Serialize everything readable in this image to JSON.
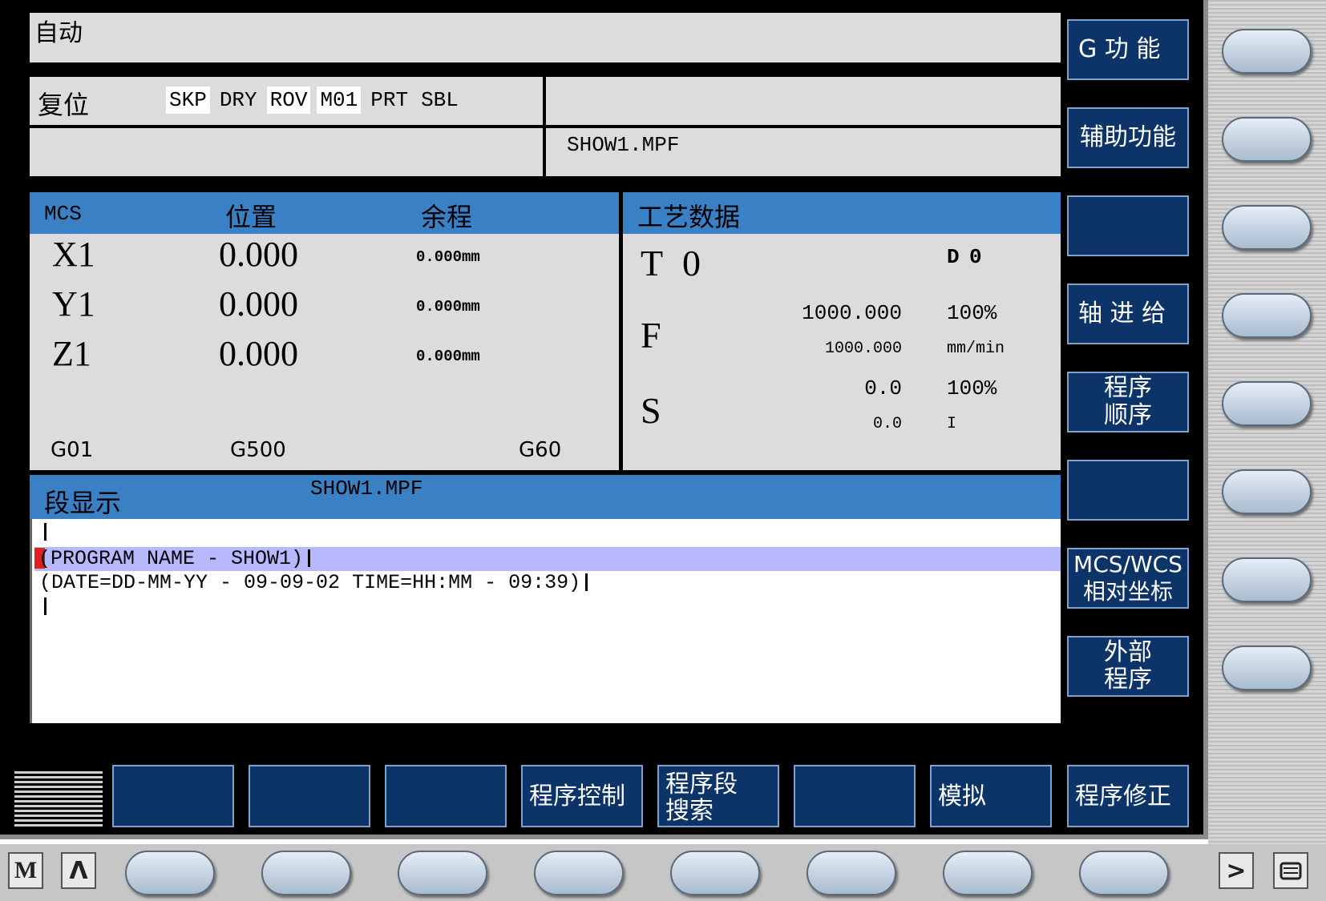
{
  "header": {
    "mode": "自动"
  },
  "status": {
    "state": "复位",
    "flags": [
      {
        "label": "SKP",
        "active": true
      },
      {
        "label": "DRY",
        "active": false
      },
      {
        "label": "ROV",
        "active": true
      },
      {
        "label": "M01",
        "active": true
      },
      {
        "label": "PRT",
        "active": false
      },
      {
        "label": "SBL",
        "active": false
      }
    ],
    "program_name": "SHOW1.MPF"
  },
  "position": {
    "headers": {
      "mcs": "MCS",
      "pos": "位置",
      "remain": "余程"
    },
    "axes": [
      {
        "name": "X1",
        "value": "0.000",
        "remain": "0.000mm"
      },
      {
        "name": "Y1",
        "value": "0.000",
        "remain": "0.000mm"
      },
      {
        "name": "Z1",
        "value": "0.000",
        "remain": "0.000mm"
      }
    ],
    "gcodes": [
      "G01",
      "G500",
      "G60"
    ]
  },
  "tech": {
    "title": "工艺数据",
    "t_label": "T",
    "t_value": "0",
    "d_label": "D",
    "d_value": "0",
    "f_label": "F",
    "f_set": "1000.000",
    "f_pct": "100%",
    "f_actual": "1000.000",
    "f_unit": "mm/min",
    "s_label": "S",
    "s_set": "0.0",
    "s_pct": "100%",
    "s_actual": "0.0",
    "s_unit": "I"
  },
  "block": {
    "title": "段显示",
    "program": "SHOW1.MPF",
    "lines": [
      "",
      "(PROGRAM NAME - SHOW1)",
      "(DATE=DD-MM-YY - 09-09-02 TIME=HH:MM - 09:39)",
      ""
    ],
    "current_line": 1
  },
  "softkeys_vertical": [
    {
      "label": "G 功 能"
    },
    {
      "label": "辅助功能"
    },
    {
      "label": ""
    },
    {
      "label": "轴 进 给"
    },
    {
      "label": "程序\n顺序"
    },
    {
      "label": ""
    },
    {
      "label": "MCS/WCS\n相对坐标"
    },
    {
      "label": "外部\n程序"
    }
  ],
  "softkeys_horizontal": [
    {
      "label": ""
    },
    {
      "label": ""
    },
    {
      "label": ""
    },
    {
      "label": "程序控制"
    },
    {
      "label": "程序段\n搜索"
    },
    {
      "label": ""
    },
    {
      "label": "模拟"
    },
    {
      "label": "程序修正"
    }
  ],
  "bottom_buttons": {
    "machine": "M",
    "recall": "Λ",
    "next": ">",
    "menu_icon": "menu-icon"
  },
  "colors": {
    "softkey_bg": "#0d3468",
    "header_blue": "#3a80c4",
    "panel_gray": "#dcdcdc",
    "highlight": "#b8b8ff",
    "cursor_red": "#e02020"
  }
}
